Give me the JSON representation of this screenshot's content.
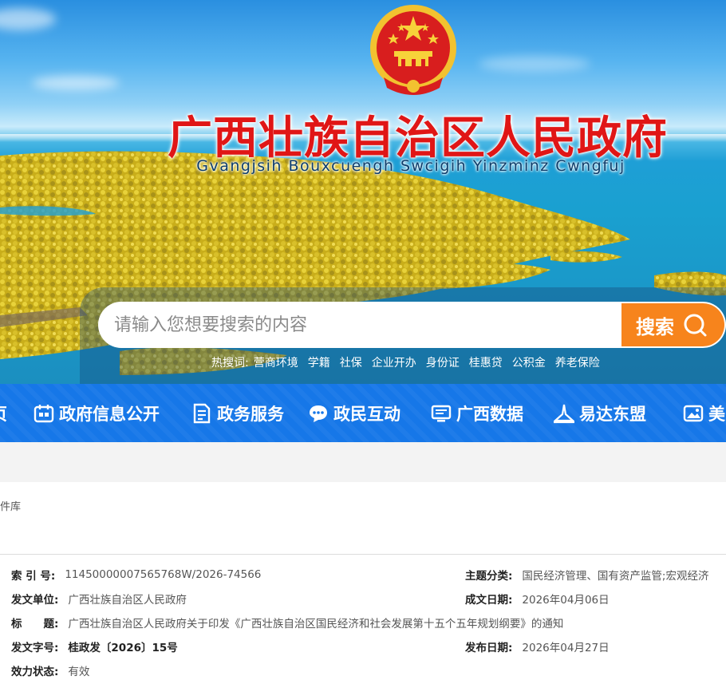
{
  "header": {
    "title": "广西壮族自治区人民政府",
    "subtitle": "Gvangjsih Bouxcuengh Swcigih Yinzminz Cwngfuj",
    "emblem_icon": "national-emblem-icon"
  },
  "search": {
    "placeholder": "请输入您想要搜索的内容",
    "button_label": "搜索",
    "hot_label": "热搜词:",
    "hot_words": [
      "营商环境",
      "学籍",
      "社保",
      "企业开办",
      "身份证",
      "桂惠贷",
      "公积金",
      "养老保险"
    ]
  },
  "nav": {
    "items": [
      {
        "label": "页",
        "icon": ""
      },
      {
        "label": "政府信息公开",
        "icon": "calendar-icon"
      },
      {
        "label": "政务服务",
        "icon": "document-icon"
      },
      {
        "label": "政民互动",
        "icon": "chat-icon"
      },
      {
        "label": "广西数据",
        "icon": "monitor-icon"
      },
      {
        "label": "易达东盟",
        "icon": "landmark-icon"
      },
      {
        "label": "美",
        "icon": "picture-icon"
      }
    ]
  },
  "breadcrumb": "件库",
  "meta": {
    "index_label": "索 引 号:",
    "index_value": "11450000007565768W/2026-74566",
    "topic_label": "主题分类:",
    "topic_value": "国民经济管理、国有资产监管;宏观经济",
    "issuer_label": "发文单位:",
    "issuer_value": "广西壮族自治区人民政府",
    "created_label": "成文日期:",
    "created_value": "2026年04月06日",
    "title_label": "标　　题:",
    "title_value": "广西壮族自治区人民政府关于印发《广西壮族自治区国民经济和社会发展第十五个五年规划纲要》的通知",
    "docno_label": "发文字号:",
    "docno_value": "桂政发〔2026〕15号",
    "published_label": "发布日期:",
    "published_value": "2026年04月27日",
    "status_label": "效力状态:",
    "status_value": "有效"
  },
  "colors": {
    "nav_blue": "#1677e8",
    "search_orange": "#f7841c",
    "title_red": "#e01616"
  }
}
